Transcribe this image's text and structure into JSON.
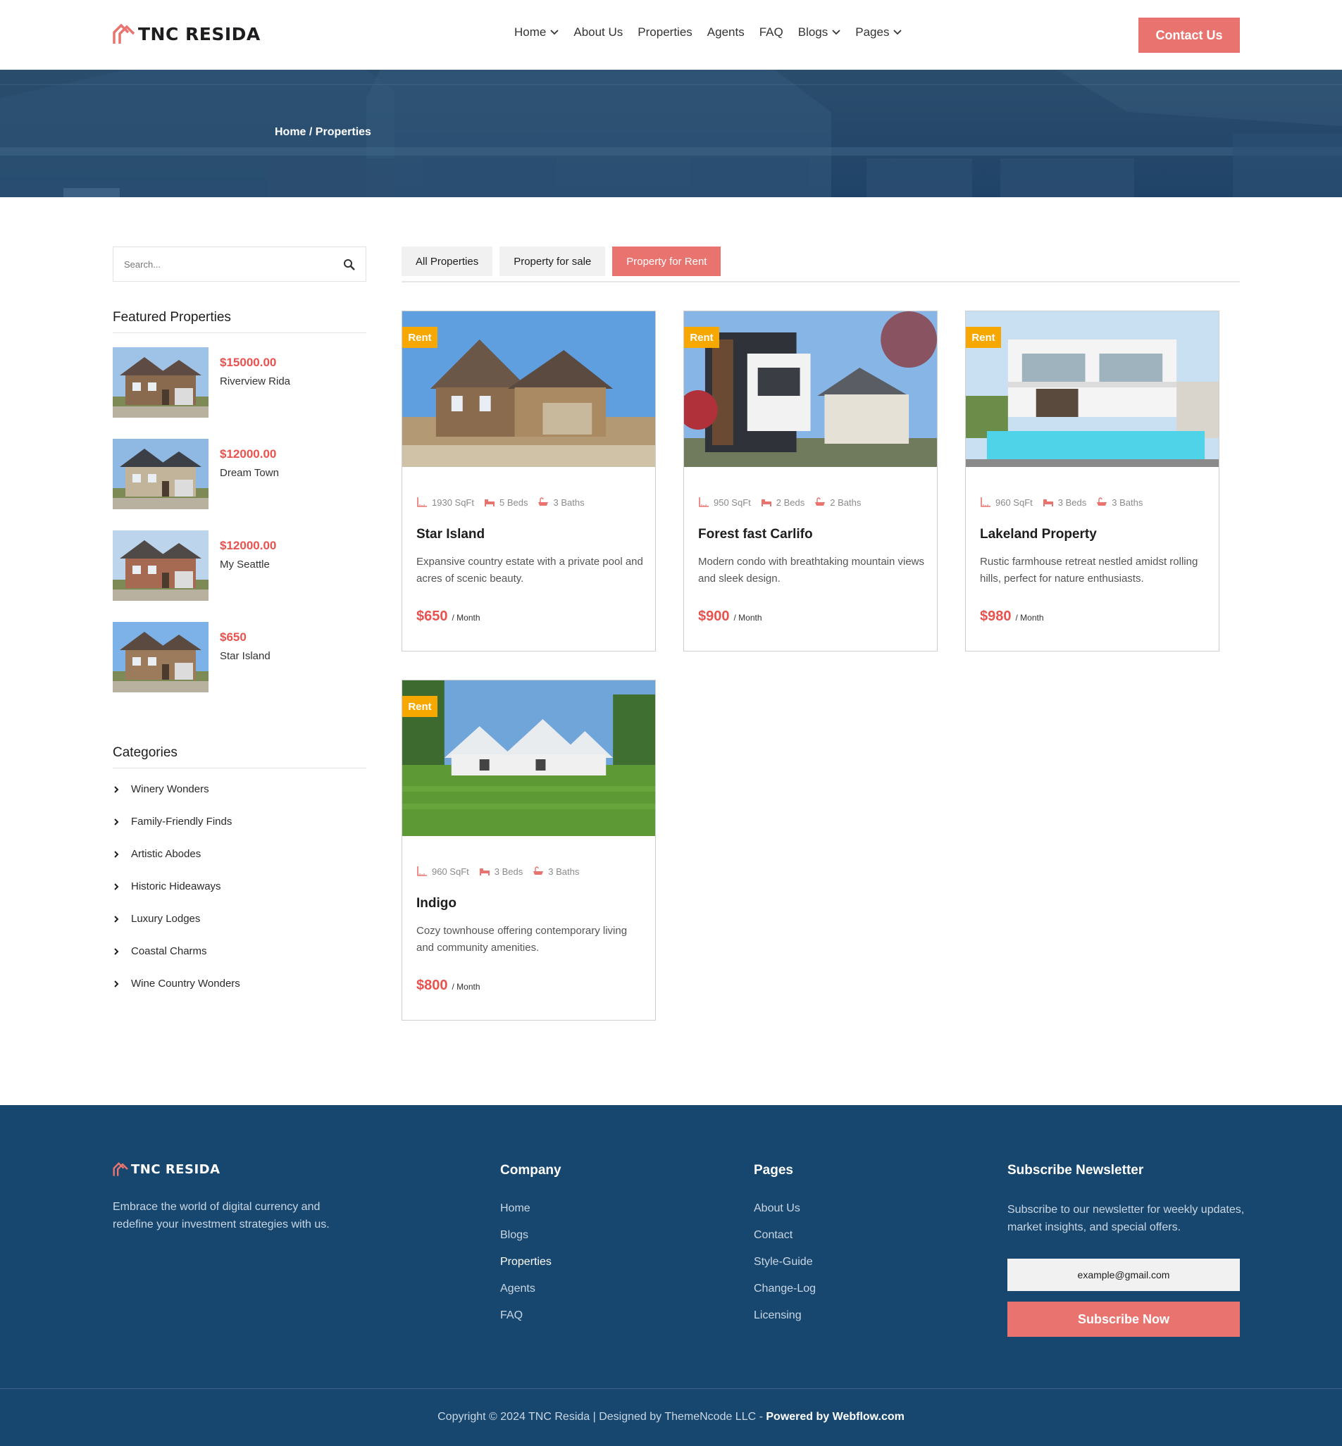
{
  "brand": {
    "name": "TNC RESIDA",
    "accent": "#e8736f",
    "navy": "#17476f",
    "price_red": "#e8524f",
    "badge_yellow": "#f6a800"
  },
  "nav": {
    "items": [
      {
        "label": "Home",
        "dropdown": true
      },
      {
        "label": "About Us",
        "dropdown": false
      },
      {
        "label": "Properties",
        "dropdown": false
      },
      {
        "label": "Agents",
        "dropdown": false
      },
      {
        "label": "FAQ",
        "dropdown": false
      },
      {
        "label": "Blogs",
        "dropdown": true
      },
      {
        "label": "Pages",
        "dropdown": true
      }
    ],
    "cta": "Contact Us"
  },
  "hero": {
    "breadcrumb": "Home / Properties"
  },
  "sidebar": {
    "search_placeholder": "Search...",
    "featured_title": "Featured Properties",
    "featured": [
      {
        "price": "$15000.00",
        "name": "Riverview Rida"
      },
      {
        "price": "$12000.00",
        "name": "Dream Town"
      },
      {
        "price": "$12000.00",
        "name": "My Seattle"
      },
      {
        "price": "$650",
        "name": "Star Island"
      }
    ],
    "categories_title": "Categories",
    "categories": [
      "Winery Wonders",
      "Family-Friendly Finds",
      "Artistic Abodes",
      "Historic Hideaways",
      "Luxury Lodges",
      "Coastal Charms",
      "Wine Country Wonders"
    ]
  },
  "tabs": [
    {
      "label": "All Properties",
      "active": false
    },
    {
      "label": "Property for sale",
      "active": false
    },
    {
      "label": "Property for Rent",
      "active": true
    }
  ],
  "cards": [
    {
      "badge": "Rent",
      "sqft": "1930 SqFt",
      "beds": "5 Beds",
      "baths": "3 Baths",
      "title": "Star Island",
      "desc": "Expansive country estate with a private pool and acres of scenic beauty.",
      "price": "$650",
      "per": "/ Month"
    },
    {
      "badge": "Rent",
      "sqft": "950 SqFt",
      "beds": "2 Beds",
      "baths": "2 Baths",
      "title": "Forest fast Carlifo",
      "desc": "Modern condo with breathtaking mountain views and sleek design.",
      "price": "$900",
      "per": "/ Month"
    },
    {
      "badge": "Rent",
      "sqft": "960 SqFt",
      "beds": "3 Beds",
      "baths": "3 Baths",
      "title": "Lakeland Property",
      "desc": "Rustic farmhouse retreat nestled amidst rolling hills, perfect for nature enthusiasts.",
      "price": "$980",
      "per": "/ Month"
    },
    {
      "badge": "Rent",
      "sqft": "960 SqFt",
      "beds": "3 Beds",
      "baths": "3 Baths",
      "title": "Indigo",
      "desc": "Cozy townhouse offering contemporary living and community amenities.",
      "price": "$800",
      "per": "/ Month"
    }
  ],
  "footer": {
    "about": "Embrace the world of digital currency and redefine your investment strategies with us.",
    "company_title": "Company",
    "company_links": [
      "Home",
      "Blogs",
      "Properties",
      "Agents",
      "FAQ"
    ],
    "pages_title": "Pages",
    "pages_links": [
      "About Us",
      "Contact",
      "Style-Guide",
      "Change-Log",
      "Licensing"
    ],
    "newsletter_title": "Subscribe Newsletter",
    "newsletter_text": "Subscribe to our newsletter for weekly updates, market insights, and special offers.",
    "email_placeholder": "example@gmail.com",
    "subscribe_label": "Subscribe Now",
    "copyright": "Copyright © 2024 TNC Resida | Designed by ThemeNcode LLC - ",
    "powered": "Powered by Webflow.com"
  }
}
